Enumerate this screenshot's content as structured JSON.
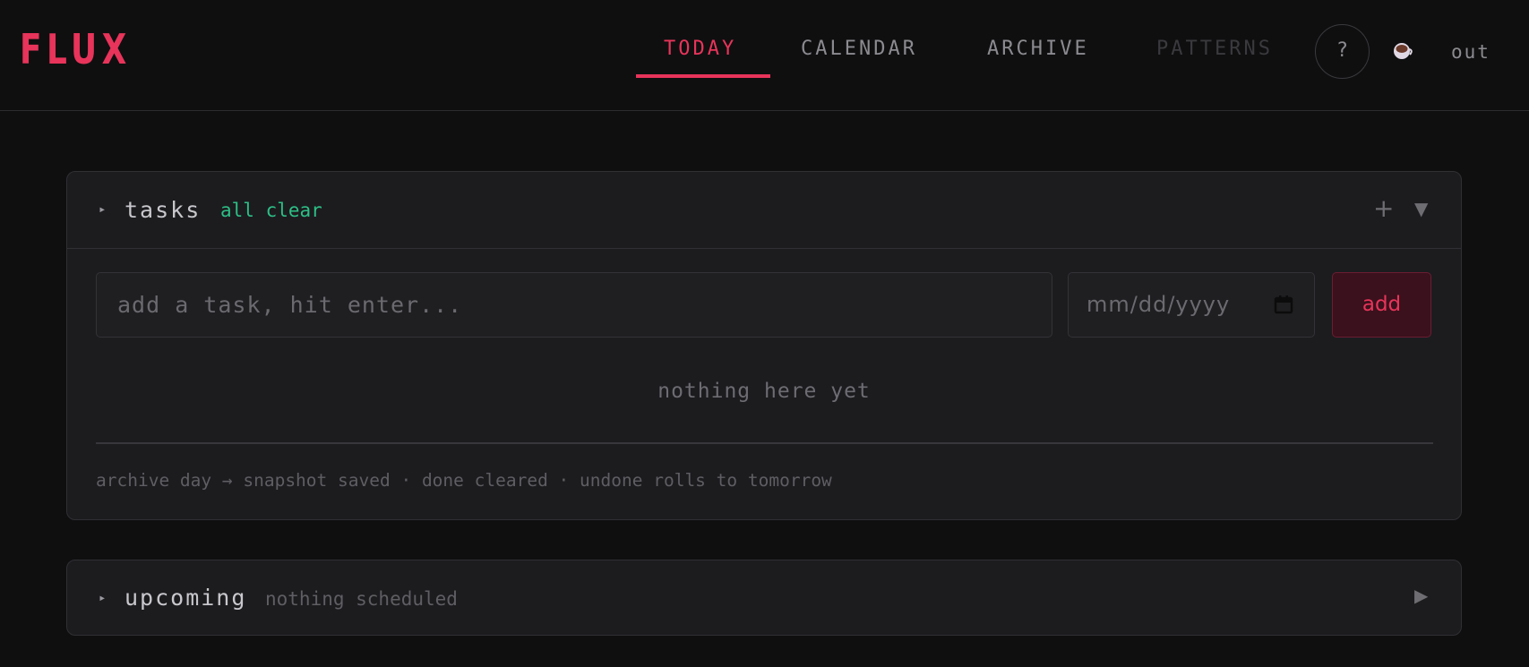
{
  "app": {
    "logo": "FLUX"
  },
  "nav": {
    "tabs": [
      {
        "label": "TODAY",
        "state": "active"
      },
      {
        "label": "CALENDAR",
        "state": "normal"
      },
      {
        "label": "ARCHIVE",
        "state": "normal"
      },
      {
        "label": "PATTERNS",
        "state": "disabled"
      }
    ],
    "help_label": "?",
    "coffee_icon": "coffee-cup-icon",
    "logout_label": "out"
  },
  "tasks": {
    "title": "tasks",
    "status": "all clear",
    "add_icon": "plus",
    "collapse_icon": "triangle-down",
    "input": {
      "value": "",
      "placeholder": "add a task, hit enter..."
    },
    "date": {
      "value": "",
      "placeholder": "mm/dd/yyyy"
    },
    "add_label": "add",
    "empty_message": "nothing here yet",
    "footer_note": "archive day → snapshot saved · done cleared · undone rolls to tomorrow"
  },
  "upcoming": {
    "title": "upcoming",
    "status": "nothing scheduled",
    "expand_icon": "triangle-right"
  },
  "colors": {
    "accent": "#e8345a",
    "success": "#2dbf86",
    "background": "#0f0f10",
    "card": "#1c1c1f"
  }
}
